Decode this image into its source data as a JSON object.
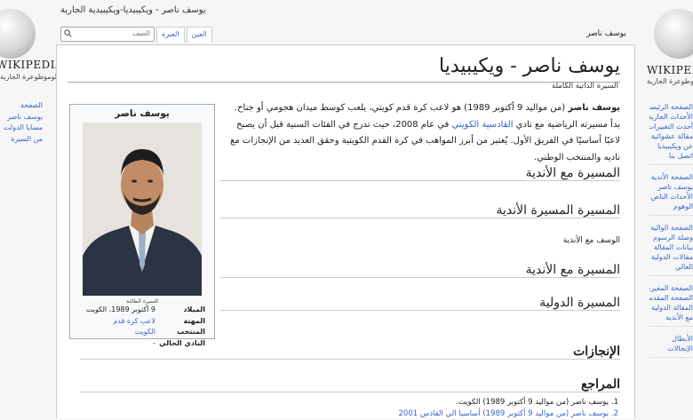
{
  "window_title": "يوسف ناصر - ويكيبيديا-ويكيبيدية الجارية",
  "left_sidebar": {
    "wordmark": "WIKIPEDIA",
    "tagline": "ملوموطوعرة الجارية",
    "items": [
      "الصفحة",
      "يوسف ناصر",
      "مسايا الدولت",
      "من السيرة"
    ]
  },
  "right_sidebar": {
    "wordmark": "WIKIPEDIA",
    "tagline": "ملوموطوعرة الجارية",
    "groups": [
      [
        "الصفحة الرئيسية",
        "الأحداث الجارية",
        "أحدث التغييرات",
        "مقالة عشوائية",
        "عن ويكيبيديا",
        "اتصل بنا"
      ],
      [
        "الصفحة الأندية",
        "يوسف ناصر",
        "الأحداث الناص",
        "الوهوم"
      ],
      [
        "الصفحة الوالية",
        "وصلة الرسوم",
        "بيانات المقالة",
        "مقالات الدولية",
        "العالي"
      ],
      [
        "الصفحة المغيرة",
        "الصفحة المقدس",
        "المقالة الدولية",
        "مع الأندية"
      ],
      [
        "الأبطال",
        "الإنجالات"
      ]
    ]
  },
  "search": {
    "placeholder": "الصف"
  },
  "tabs": [
    "العين",
    "العبرة"
  ],
  "top_right_label": "يوسف ناصر",
  "article": {
    "title": "يوسف ناصر - ويكيبيديا",
    "subtitle": "السيرة الذاتية الكاملة",
    "intro_bold": "يوسف ناصر",
    "intro_1": " (من مواليد 9 أكتوبر 1989) هو لاعب كرة قدم كويتي، يلعب كوسط ميدان هجومي أو جناح. بدأ مسيرته الرياضية مع نادي ",
    "intro_link": "القادسية الكويتي",
    "intro_2": " في عام 2008، حيث تدرج في الفئات السنية قبل أن يصبح لاعبًا أساسيًا في الفريق الأول. يُعتبر من أبرز المواهب في كرة القدم الكويتية وحقق العديد من الإنجازات مع ناديه والمنتخب الوطني.",
    "sections": [
      "المسيرة مع الأندية",
      "المسيرة المسيرة الأندية",
      "المسيرة مع الأندية",
      "المسيرة الدولية",
      "الإنجازات",
      "المراجع"
    ],
    "para_club": "الوسف مع الأندية",
    "references": [
      "1. يوسف ناصر (من مواليد 9 أكتوبر 1989) الكويت.",
      "2. يوسف ناصر (من مواليد 9 أكتوبر 1989) أساسيا الي القادس 2001"
    ]
  },
  "infobox": {
    "title": "يوسف ناصر",
    "caption": "السيرة الطائنة",
    "rows": [
      {
        "label": "الميلاد",
        "value": "9 أكتوبر 1989، الكويت",
        "link": false
      },
      {
        "label": "المهنة",
        "value": "لاعب كرة قدم",
        "link": true
      },
      {
        "label": "المنتخب",
        "value": "الكويت",
        "link": true
      },
      {
        "label": "النادي الحالي",
        "value": "-",
        "link": false
      }
    ]
  },
  "colors": {
    "link": "#3366cc",
    "border": "#a2a9b1",
    "background": "#f6f6f6"
  }
}
